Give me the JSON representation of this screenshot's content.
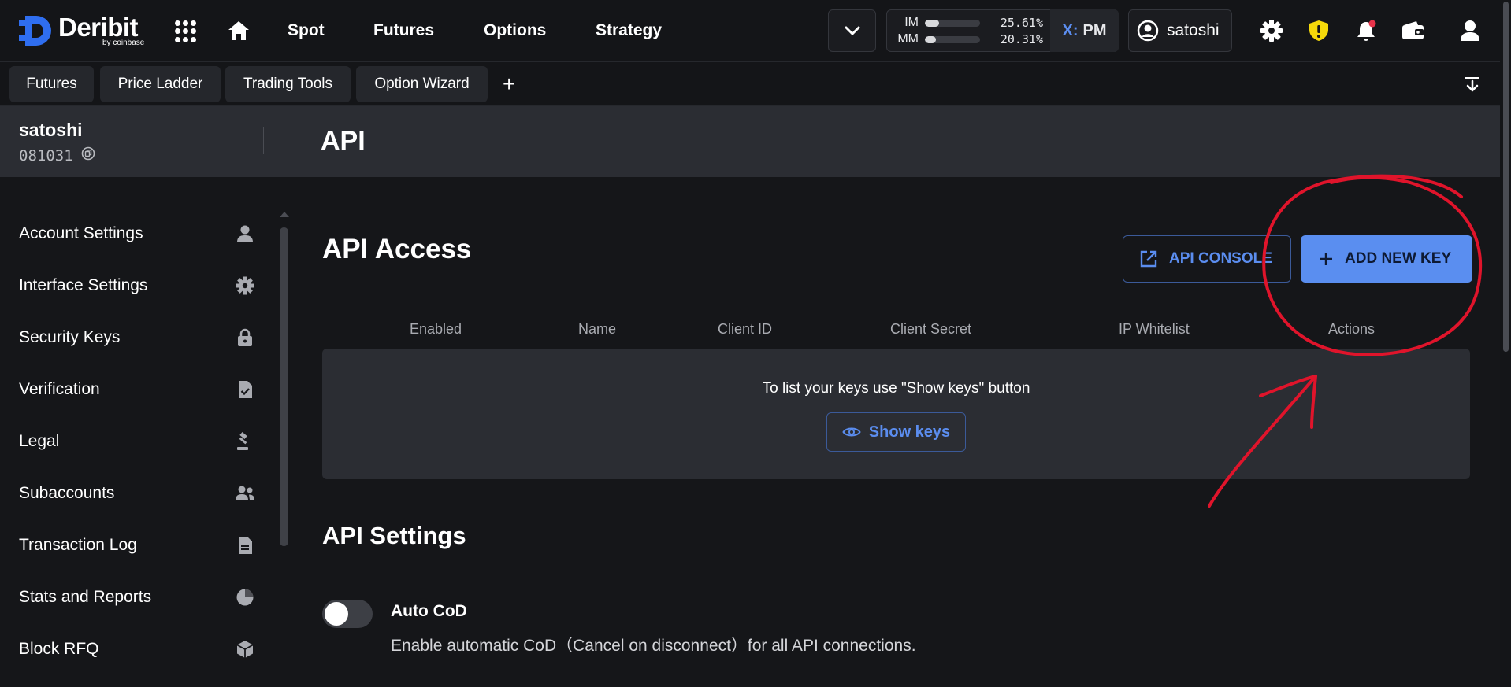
{
  "topbar": {
    "brand": "Deribit",
    "brand_sub": "by coinbase",
    "nav": [
      "Spot",
      "Futures",
      "Options",
      "Strategy"
    ],
    "margin": {
      "im_label": "IM",
      "im_pct": "25.61%",
      "im_fraction": 0.26,
      "mm_label": "MM",
      "mm_pct": "20.31%",
      "mm_fraction": 0.2
    },
    "mode_prefix": "X:",
    "mode": "PM",
    "username": "satoshi"
  },
  "tabs": [
    "Futures",
    "Price Ladder",
    "Trading Tools",
    "Option Wizard"
  ],
  "tab_add": "+",
  "account": {
    "name": "satoshi",
    "id": "081031"
  },
  "page_title": "API",
  "sidebar": [
    {
      "label": "Account Settings",
      "icon": "user-icon"
    },
    {
      "label": "Interface Settings",
      "icon": "gear-icon"
    },
    {
      "label": "Security Keys",
      "icon": "lock-icon"
    },
    {
      "label": "Verification",
      "icon": "file-check-icon"
    },
    {
      "label": "Legal",
      "icon": "gavel-icon"
    },
    {
      "label": "Subaccounts",
      "icon": "users-icon"
    },
    {
      "label": "Transaction Log",
      "icon": "document-icon"
    },
    {
      "label": "Stats and Reports",
      "icon": "pie-chart-icon"
    },
    {
      "label": "Block RFQ",
      "icon": "cube-icon"
    }
  ],
  "api_access": {
    "title": "API Access",
    "console_btn": "API CONSOLE",
    "add_btn": "ADD NEW KEY",
    "columns": [
      "Enabled",
      "Name",
      "Client ID",
      "Client Secret",
      "IP Whitelist",
      "Actions"
    ],
    "empty_msg": "To list your keys use \"Show keys\" button",
    "show_keys_btn": "Show keys"
  },
  "api_settings": {
    "title": "API Settings",
    "auto_cod_label": "Auto CoD",
    "auto_cod_desc": "Enable automatic CoD（Cancel on disconnect）for all API connections.",
    "auto_cod_enabled": false
  },
  "colors": {
    "accent": "#5a8ef0",
    "annotation": "#e0142b",
    "background": "#151619",
    "panel": "#2b2d33",
    "shield_warning": "#f5d90a",
    "notification_dot": "#e8334a"
  }
}
